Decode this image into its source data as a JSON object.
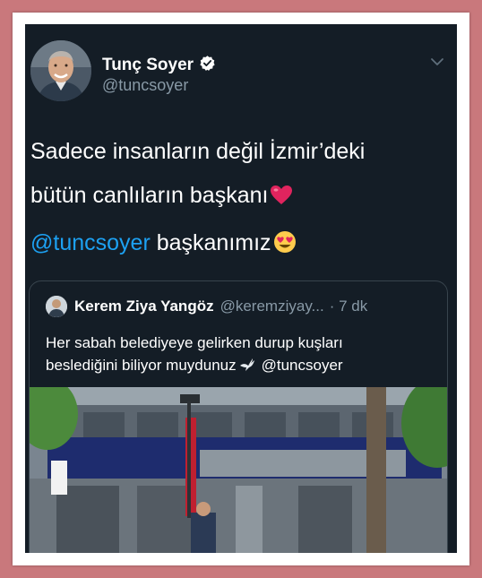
{
  "tweet": {
    "display_name": "Tunç Soyer",
    "handle": "@tuncsoyer",
    "verified_icon": "verified-badge-icon",
    "menu_icon": "chevron-down-icon",
    "text_line_1": "Sadece insanların değil İzmir’deki",
    "text_line_2": "bütün canlıların başkanı",
    "text_line_2_emoji": "red-heart-icon",
    "mention": "@tuncsoyer",
    "text_line_3_rest": " başkanımız",
    "text_line_3_emoji": "heart-eyes-face-icon"
  },
  "quoted_tweet": {
    "display_name": "Kerem Ziya Yangöz",
    "handle": "@keremziyay...",
    "time": "· 7 dk",
    "text_line_1": "Her sabah belediyeye gelirken durup kuşları",
    "text_line_2_start": "beslediğini biliyor muydunuz",
    "text_line_2_emoji": "dove-icon",
    "mention": "@tuncsoyer",
    "photo": "building-street-photo"
  },
  "colors": {
    "background": "#141d26",
    "text": "#ffffff",
    "secondary": "#8899a6",
    "link": "#1da1f2",
    "border": "#38444d",
    "outer_frame": "#c9787c"
  }
}
